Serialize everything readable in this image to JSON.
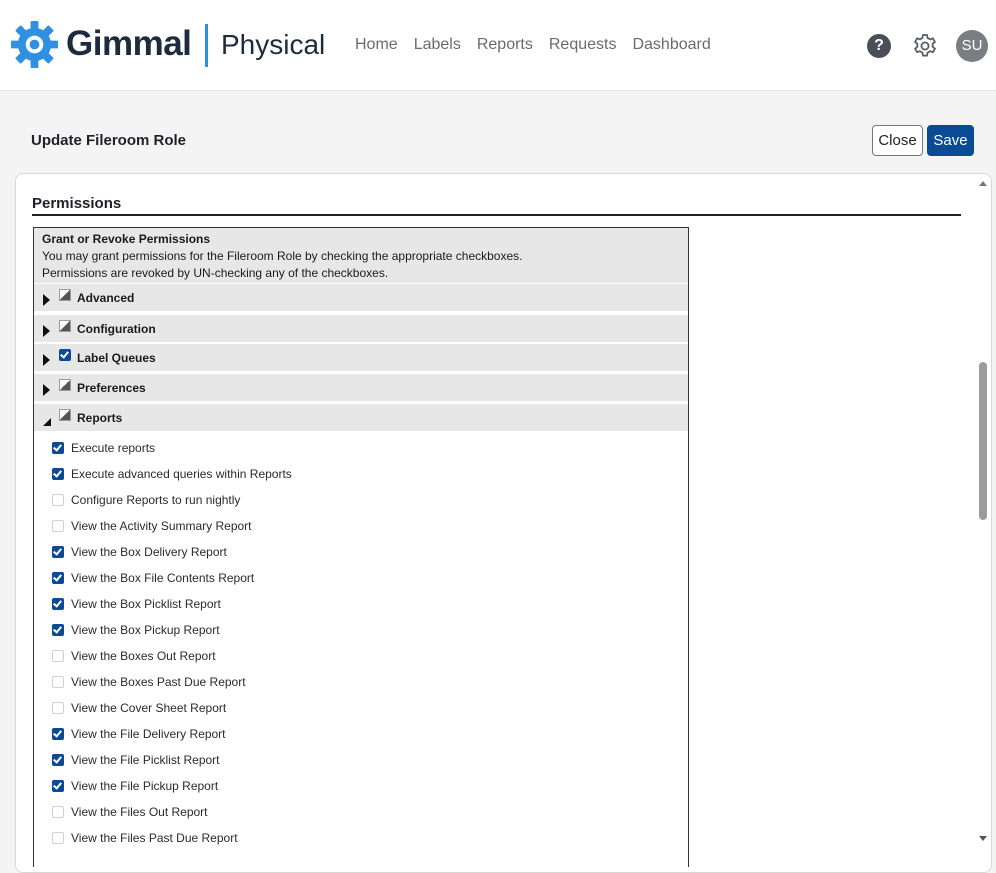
{
  "brand": {
    "company": "Gimmal",
    "product": "Physical",
    "accent": "#2f8fe0",
    "logo_icon": "gear-icon"
  },
  "nav": [
    "Home",
    "Labels",
    "Reports",
    "Requests",
    "Dashboard"
  ],
  "header_icons": {
    "help": "?",
    "settings": "gear-icon",
    "avatar": "SU"
  },
  "page": {
    "title": "Update Fileroom Role",
    "close_label": "Close",
    "save_label": "Save"
  },
  "permissions": {
    "section_title": "Permissions",
    "header_title": "Grant or Revoke Permissions",
    "header_line1": "You may grant permissions for the Fileroom Role by checking the appropriate checkboxes.",
    "header_line2": "Permissions are revoked by UN-checking any of the checkboxes.",
    "groups": [
      {
        "label": "Advanced",
        "state": "partial",
        "expanded": false
      },
      {
        "label": "Configuration",
        "state": "partial",
        "expanded": false
      },
      {
        "label": "Label Queues",
        "state": "checked",
        "expanded": false
      },
      {
        "label": "Preferences",
        "state": "partial",
        "expanded": false
      },
      {
        "label": "Reports",
        "state": "partial",
        "expanded": true
      }
    ],
    "report_items": [
      {
        "label": "Execute reports",
        "checked": true
      },
      {
        "label": "Execute advanced queries within Reports",
        "checked": true
      },
      {
        "label": "Configure Reports to run nightly",
        "checked": false
      },
      {
        "label": "View the Activity Summary Report",
        "checked": false
      },
      {
        "label": "View the Box Delivery Report",
        "checked": true
      },
      {
        "label": "View the Box File Contents Report",
        "checked": true
      },
      {
        "label": "View the Box Picklist Report",
        "checked": true
      },
      {
        "label": "View the Box Pickup Report",
        "checked": true
      },
      {
        "label": "View the Boxes Out Report",
        "checked": false
      },
      {
        "label": "View the Boxes Past Due Report",
        "checked": false
      },
      {
        "label": "View the Cover Sheet Report",
        "checked": false
      },
      {
        "label": "View the File Delivery Report",
        "checked": true
      },
      {
        "label": "View the File Picklist Report",
        "checked": true
      },
      {
        "label": "View the File Pickup Report",
        "checked": true
      },
      {
        "label": "View the Files Out Report",
        "checked": false
      },
      {
        "label": "View the Files Past Due Report",
        "checked": false
      }
    ]
  },
  "colors": {
    "primary": "#0b4a95",
    "group_bg": "#e7e7e7"
  }
}
